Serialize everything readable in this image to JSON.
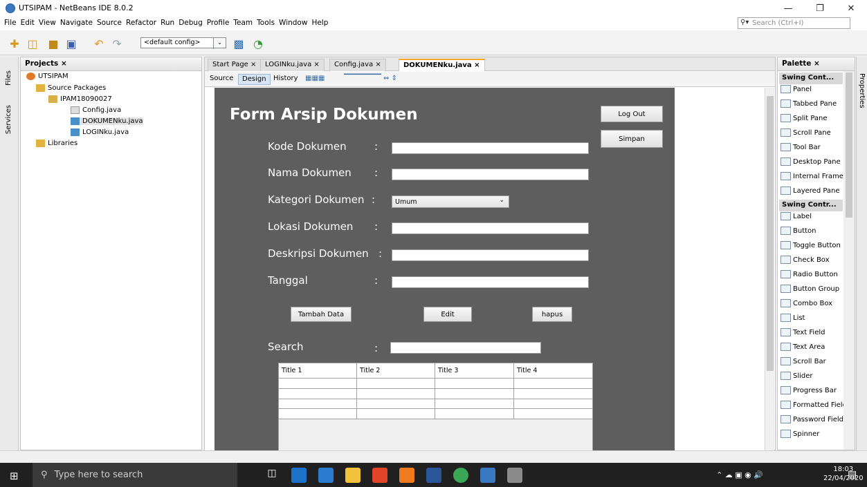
{
  "window": {
    "title": "UTSIPAM - NetBeans IDE 8.0.2"
  },
  "menu": [
    "File",
    "Edit",
    "View",
    "Navigate",
    "Source",
    "Refactor",
    "Run",
    "Debug",
    "Profile",
    "Team",
    "Tools",
    "Window",
    "Help"
  ],
  "search": {
    "placeholder": "Search (Ctrl+I)"
  },
  "toolbar": {
    "config": "<default config>"
  },
  "side_tabs": {
    "files": "Files",
    "services": "Services",
    "properties": "Properties"
  },
  "projects": {
    "header": "Projects ×",
    "tree": [
      "UTSIPAM",
      "Source Packages",
      "IPAM18090027",
      "Config.java",
      "DOKUMENku.java",
      "LOGINku.java",
      "Libraries"
    ]
  },
  "editor": {
    "tabs": [
      "Start Page",
      "LOGINku.java",
      "Config.java",
      "DOKUMENku.java"
    ],
    "modes": [
      "Source",
      "Design",
      "History"
    ]
  },
  "form": {
    "title": "Form Arsip Dokumen",
    "logout": "Log Out",
    "save": "Simpan",
    "colon": ":",
    "fields": [
      "Kode Dokumen",
      "Nama Dokumen",
      "Kategori Dokumen",
      "Lokasi Dokumen",
      "Deskripsi Dokumen",
      "Tanggal"
    ],
    "category_value": "Umum",
    "buttons": [
      "Tambah Data",
      "Edit",
      "hapus"
    ],
    "search_label": "Search",
    "columns": [
      "Title 1",
      "Title 2",
      "Title 3",
      "Title 4"
    ]
  },
  "palette": {
    "header": "Palette ×",
    "cat1": "Swing Cont...",
    "containers": [
      "Panel",
      "Tabbed Pane",
      "Split Pane",
      "Scroll Pane",
      "Tool Bar",
      "Desktop Pane",
      "Internal Frame",
      "Layered Pane"
    ],
    "cat2": "Swing Contr...",
    "controls": [
      "Label",
      "Button",
      "Toggle Button",
      "Check Box",
      "Radio Button",
      "Button Group",
      "Combo Box",
      "List",
      "Text Field",
      "Text Area",
      "Scroll Bar",
      "Slider",
      "Progress Bar",
      "Formatted Field",
      "Password Field",
      "Spinner"
    ]
  },
  "taskbar": {
    "search": "Type here to search",
    "time": "18:03",
    "date": "22/04/2020"
  }
}
